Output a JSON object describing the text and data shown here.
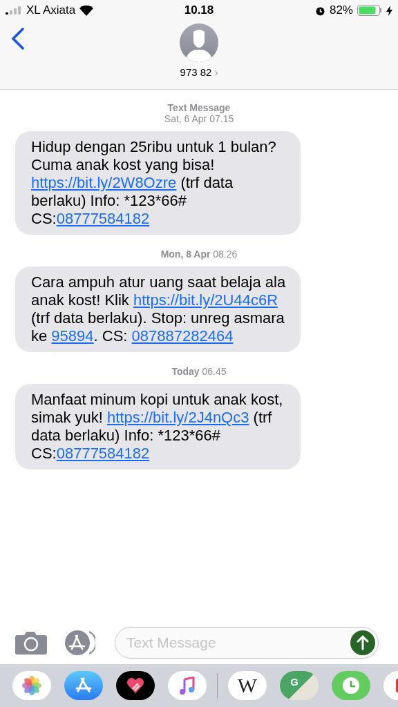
{
  "status_bar": {
    "carrier": "XL Axiata",
    "time": "10.18",
    "battery": "82%"
  },
  "header": {
    "contact": "973 82",
    "chevron": "›"
  },
  "thread": [
    {
      "kind": "stamp",
      "label": "Text Message",
      "time": "Sat, 6 Apr 07.15"
    },
    {
      "kind": "message",
      "parts": [
        {
          "text": "Hidup dengan 25ribu untuk 1 bulan? Cuma anak kost yang bisa! ",
          "link": false
        },
        {
          "text": "https://bit.ly/2W8Ozre",
          "link": true
        },
        {
          "text": " (trf data berlaku) Info: *123*66# CS:",
          "link": false
        },
        {
          "text": "08777584182",
          "link": true
        }
      ]
    },
    {
      "kind": "stamp",
      "day": "Mon, 8 Apr",
      "time": "08.26"
    },
    {
      "kind": "message",
      "parts": [
        {
          "text": "Cara ampuh atur uang saat belaja ala anak kost! Klik ",
          "link": false
        },
        {
          "text": "https://bit.ly/2U44c6R",
          "link": true
        },
        {
          "text": " (trf data berlaku). Stop: unreg asmara ke ",
          "link": false
        },
        {
          "text": "95894",
          "link": true
        },
        {
          "text": ". CS: ",
          "link": false
        },
        {
          "text": "087887282464",
          "link": true
        }
      ]
    },
    {
      "kind": "stamp",
      "day": "Today",
      "time": "06.45"
    },
    {
      "kind": "message",
      "parts": [
        {
          "text": "Manfaat minum kopi untuk anak kost, simak yuk! ",
          "link": false
        },
        {
          "text": "https://bit.ly/2J4nQc3",
          "link": true
        },
        {
          "text": " (trf data berlaku) Info: *123*66# CS:",
          "link": false
        },
        {
          "text": "08777584182",
          "link": true
        }
      ]
    }
  ],
  "composer": {
    "placeholder": "Text Message"
  },
  "app_drawer": [
    {
      "kind": "photos"
    },
    {
      "kind": "appstore"
    },
    {
      "kind": "heart"
    },
    {
      "kind": "music"
    },
    {
      "kind": "divider"
    },
    {
      "kind": "wiki",
      "label": "W"
    },
    {
      "kind": "maps",
      "label": "G"
    },
    {
      "kind": "clock"
    },
    {
      "kind": "partial"
    }
  ]
}
